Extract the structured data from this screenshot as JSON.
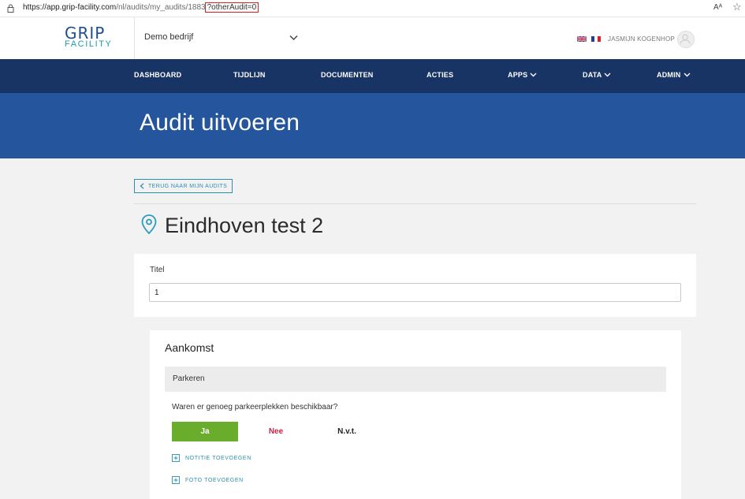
{
  "browser": {
    "url_host": "https://app.grip-facility.com",
    "url_path": "/nl/audits/my_audits/1883",
    "url_query": "?otherAudit=0",
    "read_aloud_label": "Aᴬ"
  },
  "header": {
    "logo_line1": "GRIP",
    "logo_line2": "FACILITY",
    "company": "Demo bedrijf",
    "user_name": "JASMIJN KOGENHOP"
  },
  "nav": {
    "items": [
      {
        "label": "DASHBOARD"
      },
      {
        "label": "TIJDLIJN"
      },
      {
        "label": "DOCUMENTEN"
      },
      {
        "label": "ACTIES"
      },
      {
        "label": "APPS"
      },
      {
        "label": "DATA"
      },
      {
        "label": "ADMIN"
      }
    ]
  },
  "banner": {
    "title": "Audit uitvoeren"
  },
  "back_button": {
    "label": "TERUG NAAR MIJN AUDITS"
  },
  "location": {
    "title": "Eindhoven test 2"
  },
  "titel_field": {
    "label": "Titel",
    "value": "1"
  },
  "section": {
    "title": "Aankomst",
    "subheading": "Parkeren",
    "question": "Waren er genoeg parkeerplekken beschikbaar?",
    "options": [
      "Ja",
      "Nee",
      "N.v.t."
    ],
    "selected": "Ja",
    "add_note_label": "NOTITIE TOEVOEGEN",
    "add_photo_label": "FOTO TOEVOEGEN"
  },
  "colors": {
    "nav_bg": "#173464",
    "banner_bg": "#25559c",
    "accent": "#2a8fb0",
    "yes_green": "#6aac2b",
    "no_red": "#c8203e"
  }
}
